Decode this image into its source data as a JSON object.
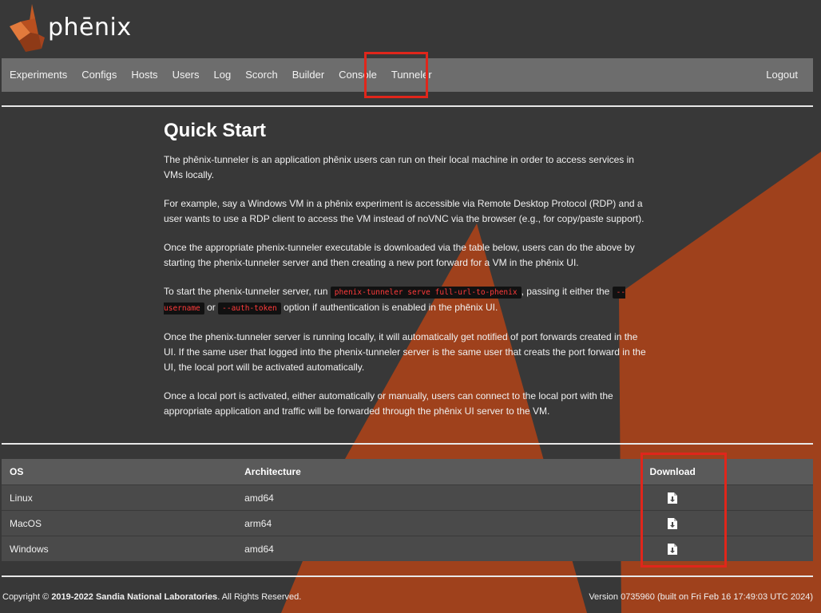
{
  "brand": {
    "name": "phēnix"
  },
  "nav": {
    "items": [
      "Experiments",
      "Configs",
      "Hosts",
      "Users",
      "Log",
      "Scorch",
      "Builder",
      "Console",
      "Tunneler"
    ],
    "logout": "Logout"
  },
  "quickstart": {
    "title": "Quick Start",
    "p1": "The phēnix-tunneler is an application phēnix users can run on their local machine in order to access services in VMs locally.",
    "p2": "For example, say a Windows VM in a phēnix experiment is accessible via Remote Desktop Protocol (RDP) and a user wants to use a RDP client to access the VM instead of noVNC via the browser (e.g., for copy/paste support).",
    "p3": "Once the appropriate phenix-tunneler executable is downloaded via the table below, users can do the above by starting the phenix-tunneler server and then creating a new port forward for a VM in the phēnix UI.",
    "p4_a": "To start the phenix-tunneler server, run",
    "p4_cmd": "phenix-tunneler serve full-url-to-phenix",
    "p4_b": ", passing it either the",
    "p4_opt1": "--username",
    "p4_c": "or",
    "p4_opt2": "--auth-token",
    "p4_d": "option if authentication is enabled in the phēnix UI.",
    "p5": "Once the phenix-tunneler server is running locally, it will automatically get notified of port forwards created in the UI. If the same user that logged into the phenix-tunneler server is the same user that creats the port forward in the UI, the local port will be activated automatically.",
    "p6": "Once a local port is activated, either automatically or manually, users can connect to the local port with the appropriate application and traffic will be forwarded through the phēnix UI server to the VM."
  },
  "table": {
    "headers": {
      "os": "OS",
      "arch": "Architecture",
      "download": "Download"
    },
    "rows": [
      {
        "os": "Linux",
        "arch": "amd64"
      },
      {
        "os": "MacOS",
        "arch": "arm64"
      },
      {
        "os": "Windows",
        "arch": "amd64"
      }
    ]
  },
  "footer": {
    "copyright_prefix": "Copyright ©",
    "copyright_holder": "2019-2022 Sandia National Laboratories",
    "copyright_suffix": ". All Rights Reserved.",
    "version": "Version 0735960 (built on Fri Feb 16 17:49:03 UTC 2024)"
  },
  "colors": {
    "accent": "#a5431d",
    "highlight": "#e0261b",
    "navbar": "#6d6d6d",
    "background": "#383838"
  },
  "icons": {
    "download": "file-download-icon"
  }
}
